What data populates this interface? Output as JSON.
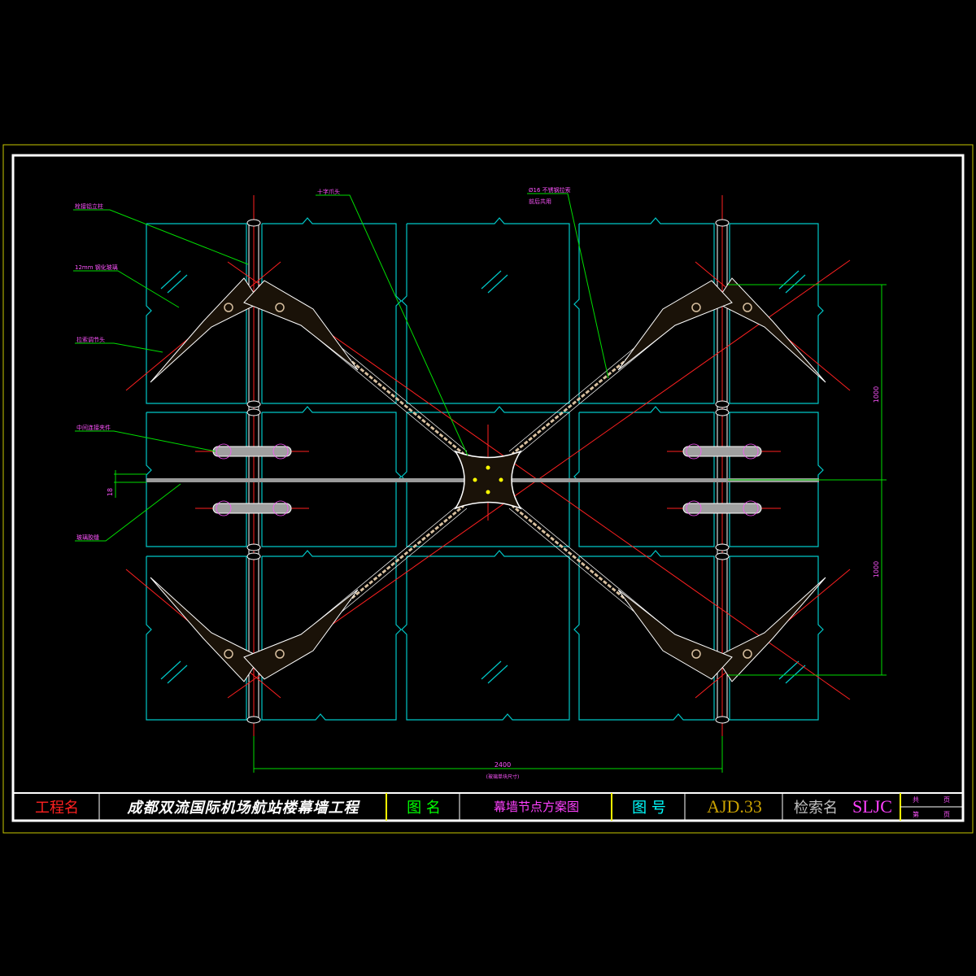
{
  "colors": {
    "frame_outer": "#c8c800",
    "frame_inner": "#ffffff",
    "glass": "#00c8c8",
    "axis": "#ff2020",
    "leader": "#00dd00",
    "label": "#ff55ff",
    "cable": "#d8c0a0",
    "joint": "#ffffff",
    "title_red": "#ff2020",
    "title_green": "#00ff00",
    "title_cyan": "#00ffff",
    "title_gold": "#c8a000",
    "title_grey": "#c0c0c0",
    "title_magenta": "#ff40ff"
  },
  "callouts": {
    "label_1": "栓接铝立柱",
    "label_2": "12mm 钢化玻璃",
    "label_3": "拉索调节头",
    "label_4": "中间连接夹件",
    "label_5": "玻璃胶缝",
    "label_6": "十字爪头",
    "label_7": "Ø16 不锈钢拉索",
    "label_8": "前后共用"
  },
  "dimensions": {
    "vertical_upper": "1000",
    "vertical_lower": "1000",
    "horizontal": "2400",
    "horizontal_note": "(玻璃单块尺寸)",
    "joint_gap": "18"
  },
  "title_block": {
    "project_label": "工程名",
    "project_name": "成都双流国际机场航站楼幕墙工程",
    "drawing_label": "图  名",
    "drawing_name": "幕墙节点方案图",
    "number_label": "图  号",
    "number_value": "AJD.33",
    "index_label": "检索名",
    "index_value": "SLJC",
    "sheet_total_label": "共",
    "sheet_total_unit": "页",
    "sheet_no_label": "第",
    "sheet_no_unit": "页"
  }
}
